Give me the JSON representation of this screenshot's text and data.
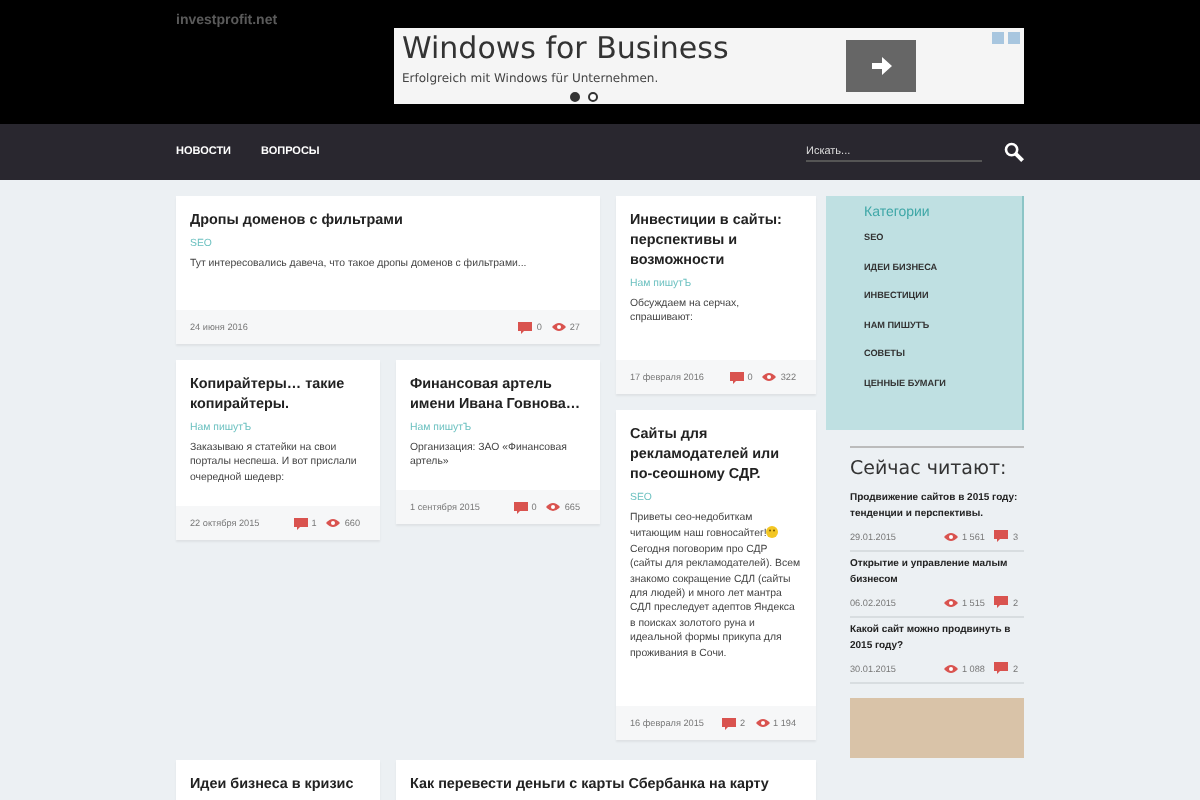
{
  "header": {
    "logo": "investprofit.net"
  },
  "ad": {
    "title": "Windows for Business",
    "subtitle": "Erfolgreich mit Windows für Unternehmen.",
    "dots": [
      {
        "selected": true
      },
      {
        "selected": false
      }
    ]
  },
  "nav": {
    "items": [
      "НОВОСТИ",
      "ВОПРОСЫ"
    ],
    "search": {
      "placeholder": "Искать..."
    }
  },
  "posts": [
    {
      "title": "Дропы доменов с фильтрами",
      "category": "SEO",
      "excerpt": "Тут интересовались давеча, что такое дропы доменов с фильтрами...",
      "date": "24 июня 2016",
      "comments": "0",
      "views": "27"
    },
    {
      "title": "Инвестиции в сайты: перспективы и возможности",
      "category": "Нам пишутЪ",
      "excerpt": "Обсуждаем на серчах, спрашивают:",
      "date": "17 февраля 2016",
      "comments": "0",
      "views": "322"
    },
    {
      "title": "Копирайтеры… такие копирайтеры.",
      "category": "Нам пишутЪ",
      "excerpt": "Заказываю я статейки на свои порталы неспеша. И вот прислали очередной шедевр:",
      "date": "22 октября 2015",
      "comments": "1",
      "views": "660"
    },
    {
      "title": "Финансовая артель имени Ивана Говнова…",
      "category": "Нам пишутЪ",
      "excerpt": "Организация: ЗАО «Финансовая артель»",
      "date": "1 сентября 2015",
      "comments": "0",
      "views": "665"
    },
    {
      "title": "Сайты для рекламодателей или по-сеошному СДР.",
      "category": "SEO",
      "excerpt": "Приветы сео-недобиткам читающим наш говносайтег!",
      "excerpt_after": "Сегодня поговорим про СДР (сайты для рекламодателей). Всем знакомо сокращение СДЛ (сайты для людей) и много лет мантра СДЛ преследует адептов Яндекса в поисках золотого руна и идеальной формы прикупа для проживания в Сочи.",
      "date": "16 февраля 2015",
      "comments": "2",
      "views": "1 194"
    },
    {
      "title": "Идеи бизнеса в кризис"
    },
    {
      "title": "Как перевести деньги с карты Сбербанка на карту"
    }
  ],
  "sidebar": {
    "categories_title": "Категории",
    "categories": [
      "SEO",
      "ИДЕИ БИЗНЕСА",
      "ИНВЕСТИЦИИ",
      "НАМ ПИШУТЪ",
      "СОВЕТЫ",
      "ЦЕННЫЕ БУМАГИ"
    ],
    "reading_title": "Сейчас читают:",
    "reading": [
      {
        "title": "Продвижение сайтов в 2015 году: тенденции и перспективы.",
        "date": "29.01.2015",
        "views": "1 561",
        "comments": "3"
      },
      {
        "title": "Открытие и управление малым бизнесом",
        "date": "06.02.2015",
        "views": "1 515",
        "comments": "2"
      },
      {
        "title": "Какой сайт можно продвинуть в 2015 году?",
        "date": "30.01.2015",
        "views": "1 088",
        "comments": "2"
      }
    ]
  }
}
